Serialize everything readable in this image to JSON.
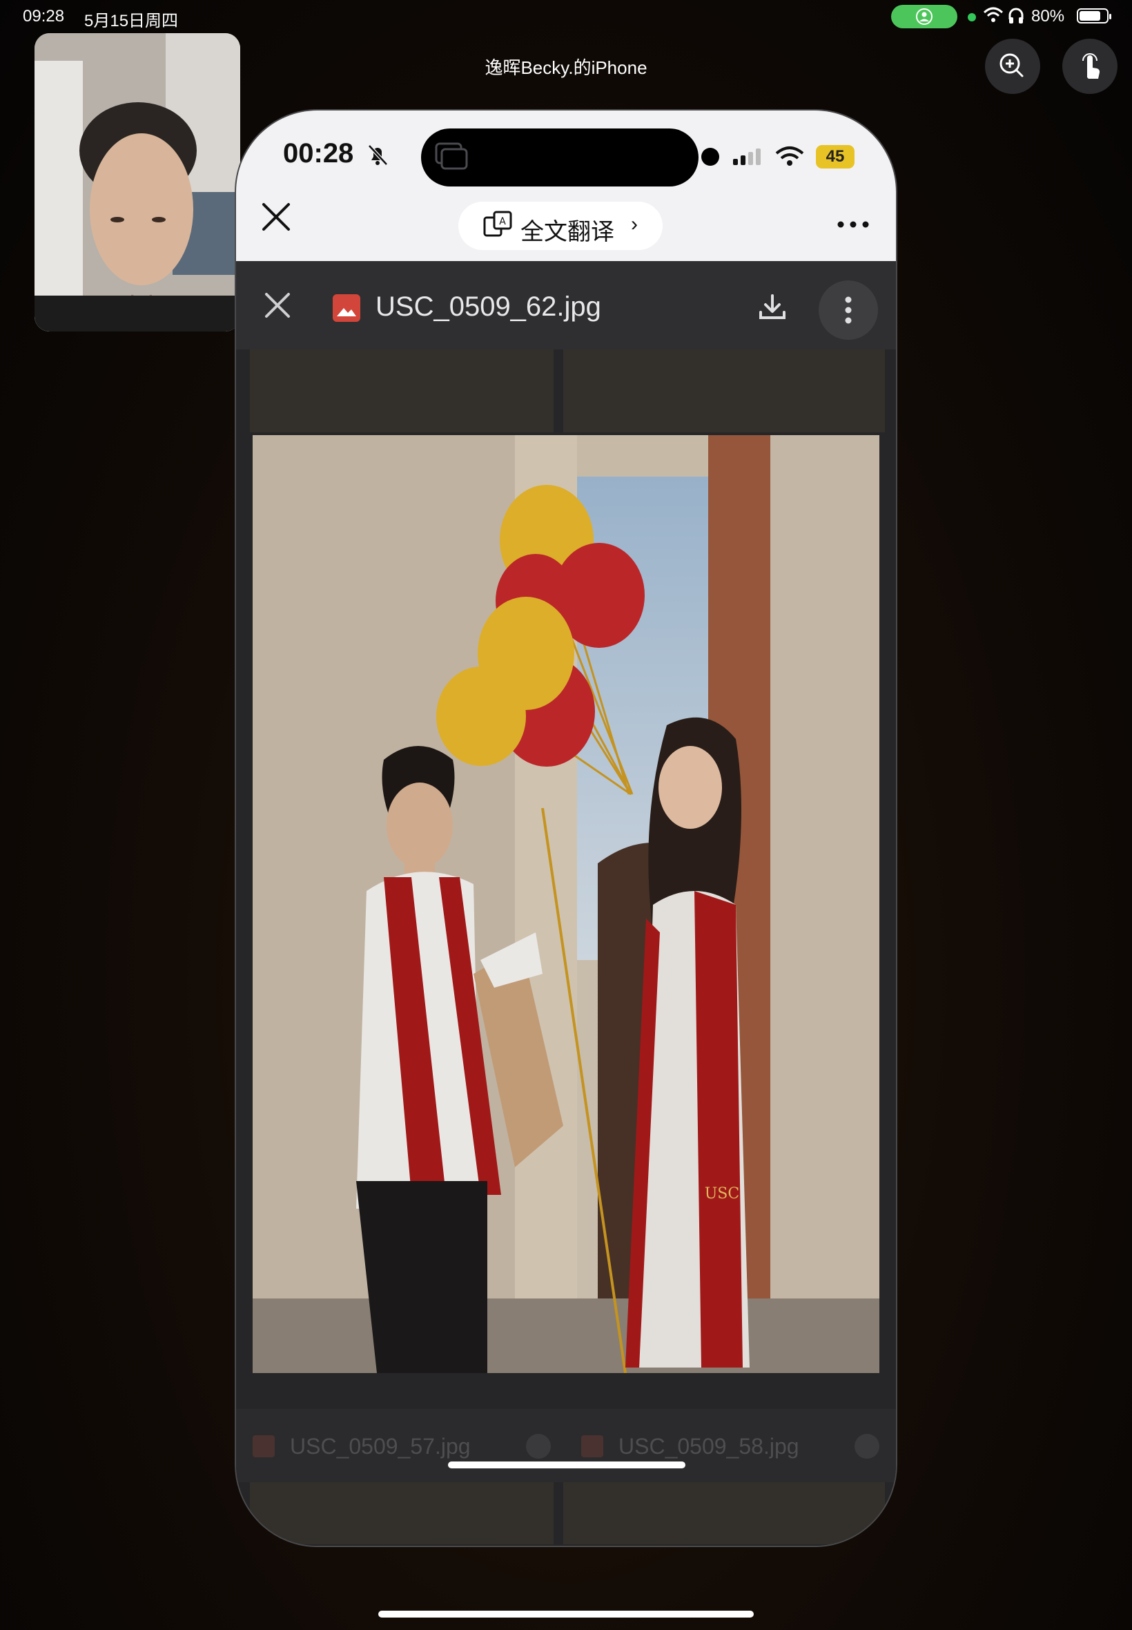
{
  "ipad_status": {
    "time": "09:28",
    "date": "5月15日周四",
    "battery_text": "80%",
    "battery_level": 0.8,
    "icons": [
      "screen-share-icon",
      "wifi-icon",
      "headphones-icon",
      "battery-icon"
    ]
  },
  "mirror": {
    "title": "逸晖Becky.的iPhone",
    "zoom_icon": "zoom-in-icon",
    "touch_icon": "touch-control-icon"
  },
  "phone_status": {
    "time": "00:28",
    "battery": "45",
    "icons": [
      "bell-slash-icon",
      "signal-icon",
      "wifi-icon",
      "battery-icon"
    ]
  },
  "phone_toolbar": {
    "translate_label": "全文翻译",
    "translate_arrow": "›"
  },
  "viewer": {
    "file_name": "USC_0509_62.jpg"
  },
  "background_files": [
    {
      "name": "USC_0509_57.jpg"
    },
    {
      "name": "USC_0509_58.jpg"
    }
  ],
  "colors": {
    "accent_green": "#4cc65a",
    "phone_battery": "#e8c326",
    "file_icon": "#d2453a",
    "sash_red": "#a81a1a",
    "balloon_yellow": "#e8b62a",
    "balloon_red": "#c2282a"
  }
}
